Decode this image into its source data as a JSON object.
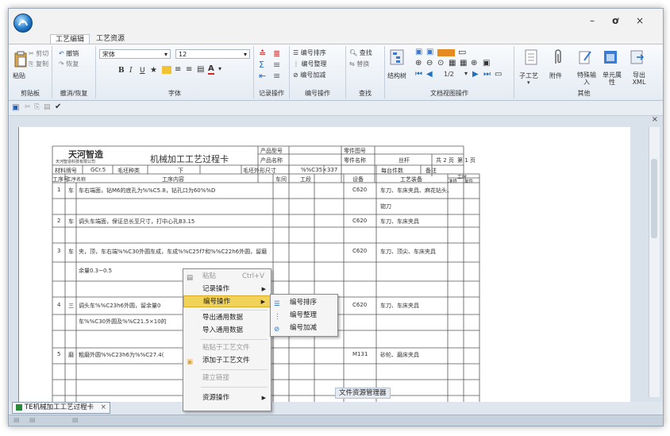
{
  "window": {
    "minimize": "–",
    "maximize": "□",
    "close": "×"
  },
  "tabs": [
    "工艺编辑",
    "工艺资源"
  ],
  "ribbon": {
    "paste": "粘贴",
    "cut": "剪切",
    "copy": "复制",
    "undo": "撤销",
    "redo": "恢复",
    "font_name": "宋体",
    "font_size": "12",
    "record_ops": "记录操作",
    "num_sort": "编号排序",
    "num_arrange": "编号整理",
    "num_add": "编号加减",
    "find": "查找",
    "replace": "替换",
    "struct_tree": "结构树",
    "page_indicator": "1/2",
    "child_proc": "子工艺",
    "attach": "附件",
    "special_input": "特殊输入",
    "cell_attr": "单元属性",
    "export_xml": "导出XML",
    "groups": [
      "剪贴板",
      "撤消/恢复",
      "字体",
      "记录操作",
      "编号操作",
      "查找",
      "文档视图操作",
      "其他"
    ]
  },
  "doc": {
    "company": "天河智造",
    "company_sub": "天河智造科技有限公司",
    "title": "机械加工工艺过程卡",
    "product_model_label": "产品型号",
    "product_name_label": "产品名称",
    "part_no_label": "零件图号",
    "part_name_label": "零件名称",
    "part_name": "丝杆",
    "pages": "共 2 页",
    "page_no": "第 1 页",
    "material_label": "材料牌号",
    "material": "GCr.5",
    "blank_type_label": "毛坯种类",
    "blank_type": "下",
    "blank_size_label": "毛坯外形尺寸",
    "blank_size": "%%C35×337",
    "per_blank_label": "每台件数",
    "remarks_label": "备注",
    "hdr_no": "工序号",
    "hdr_name": "工序名称",
    "hdr_content": "工序内容",
    "hdr_workshop": "车间",
    "hdr_section": "工段",
    "hdr_equip": "设备",
    "hdr_tooling": "工艺装备",
    "hdr_hours": "工时",
    "hdr_prep": "准终",
    "hdr_unit": "单件",
    "rows": [
      {
        "no": "1",
        "name": "车",
        "content": "车右端面，钻M6的底孔为%%C5.8，钻孔口为60%%D",
        "equip": "C620",
        "tooling": "车刀、车床夹具、麻花钻头、",
        "tooling2": "锪刀"
      },
      {
        "no": "2",
        "name": "车",
        "content": "调头车端面，保证总长至尺寸，打中心孔B3.15",
        "equip": "C620",
        "tooling": "车刀、车床夹具"
      },
      {
        "no": "3",
        "name": "车",
        "content": "夹，顶，车右端%%C30外圆车成，车成%%C25f7和%%C22h6外圆，留磨",
        "content2": "余量0.3~0.5",
        "equip": "C620",
        "tooling": "车刀、顶尖、车床夹具"
      },
      {
        "no": "4",
        "name": "三",
        "content": "调头车%%C23h6外圆，留余量0",
        "content2": "车%%C30外圆及%%C21.5×10的",
        "equip": "C620",
        "tooling": "车刀、车床夹具"
      },
      {
        "no": "5",
        "name": "磨",
        "content": "粗磨外圆%%C23h6为%%C27.4(",
        "equip": "M131",
        "tooling": "砂轮、磨床夹具"
      }
    ]
  },
  "doc_tab_label": "TE机械加工工艺过程卡",
  "doc_tab_close": "×",
  "float_label": "文件资源管理器",
  "context_menu": {
    "paste": "粘贴",
    "paste_shortcut": "Ctrl+V",
    "record_ops": "记录操作",
    "num_ops": "编号操作",
    "export_common": "导出通用数据",
    "import_common": "导入通用数据",
    "paste_to_proc": "粘贴于工艺文件",
    "add_child": "添加子工艺文件",
    "create_link": "建立链接",
    "resource_ops": "资源操作"
  },
  "submenu": {
    "sort": "编号排序",
    "arrange": "编号整理",
    "add": "编号加减"
  }
}
